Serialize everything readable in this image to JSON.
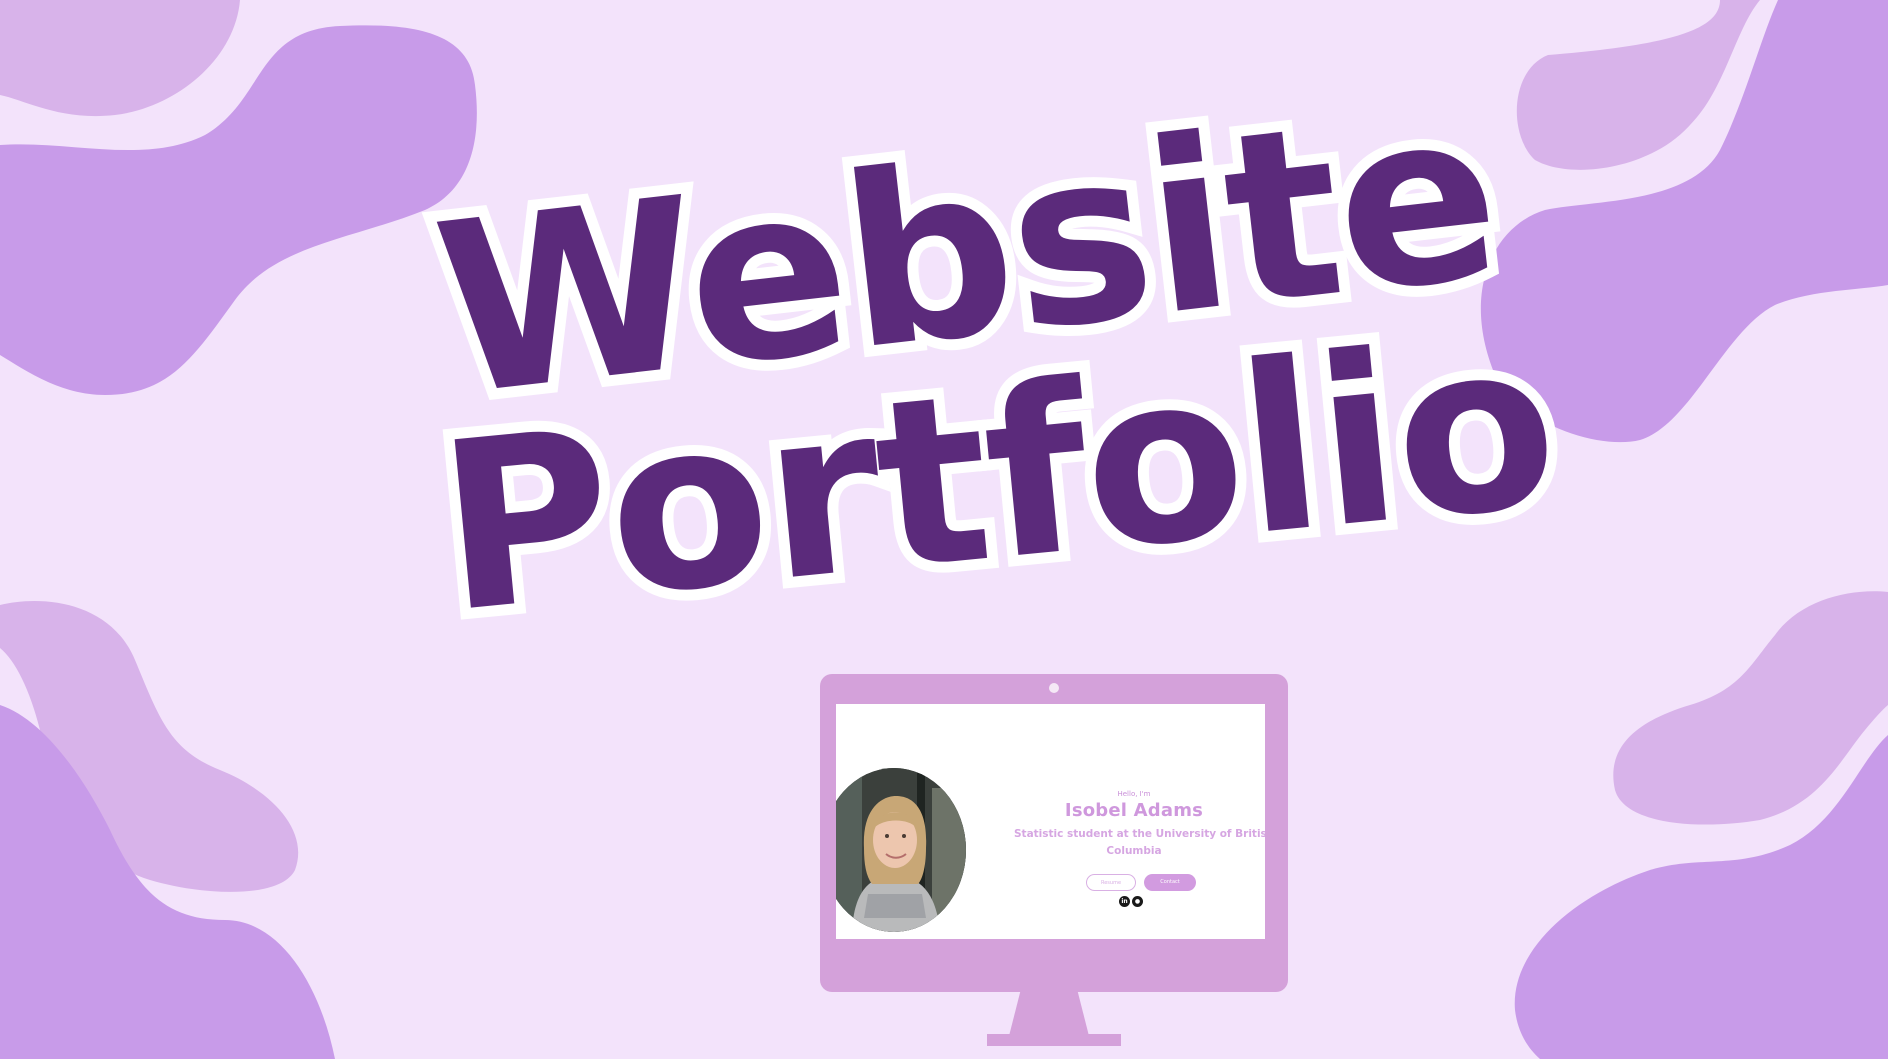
{
  "title": {
    "line1": "Website",
    "line2": "Portfolio"
  },
  "colors": {
    "background": "#f3e3fb",
    "blob_dark": "#c89be9",
    "blob_light": "#d8b3ea",
    "title": "#5b2a7b",
    "monitor": "#d4a1da",
    "accent": "#cf98dd"
  },
  "monitor_site": {
    "greeting": "Hello, I'm",
    "name": "Isobel Adams",
    "subtitle_line1": "Statistic student at the University of British",
    "subtitle_line2": "Columbia",
    "buttons": {
      "resume": "Resume",
      "contact": "Contact"
    },
    "social_icons": [
      "linkedin-icon",
      "github-icon"
    ],
    "linkedin_glyph": "in",
    "github_glyph": "●"
  }
}
